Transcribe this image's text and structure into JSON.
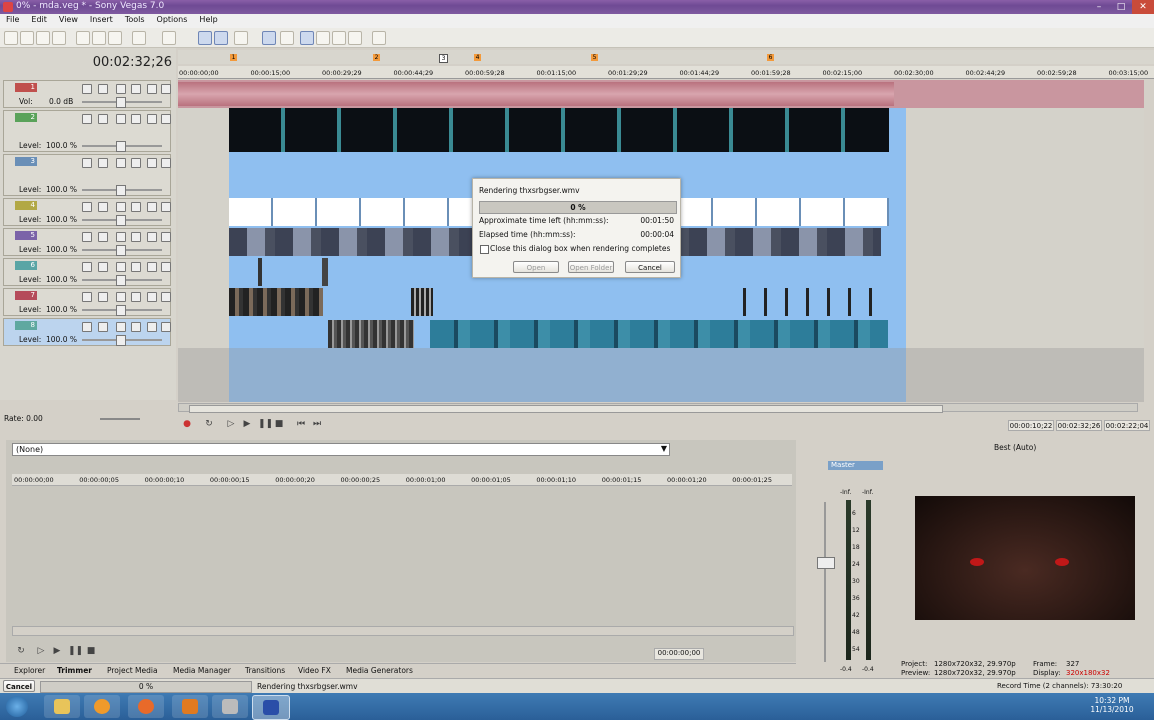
{
  "window": {
    "title": "0% - mda.veg * - Sony Vegas 7.0",
    "minimize": "–",
    "maximize": "□",
    "close": "✕"
  },
  "menu": [
    "File",
    "Edit",
    "View",
    "Insert",
    "Tools",
    "Options",
    "Help"
  ],
  "timecode": "00:02:32;26",
  "markers": [
    "1",
    "2",
    "3",
    "4",
    "5",
    "6"
  ],
  "ruler": [
    "00:00:00;00",
    "00:00:15;00",
    "00:00:29;29",
    "00:00:44;29",
    "00:00:59;28",
    "00:01:15;00",
    "00:01:29;29",
    "00:01:44;29",
    "00:01:59;28",
    "00:02:15;00",
    "00:02:30;00",
    "00:02:44;29",
    "00:02:59;28",
    "00:03:15;00"
  ],
  "tracks": [
    {
      "num": "1",
      "label": "Vol:",
      "value": "0.0 dB",
      "color": "#c0504d"
    },
    {
      "num": "2",
      "label": "Level:",
      "value": "100.0 %",
      "color": "#5aa25a"
    },
    {
      "num": "3",
      "label": "Level:",
      "value": "100.0 %",
      "color": "#6a8fb7"
    },
    {
      "num": "4",
      "label": "Level:",
      "value": "100.0 %",
      "color": "#b2a845"
    },
    {
      "num": "5",
      "label": "Level:",
      "value": "100.0 %",
      "color": "#7b63a8"
    },
    {
      "num": "6",
      "label": "Level:",
      "value": "100.0 %",
      "color": "#5aa5a5"
    },
    {
      "num": "7",
      "label": "Level:",
      "value": "100.0 %",
      "color": "#b54b5a"
    },
    {
      "num": "8",
      "label": "Level:",
      "value": "100.0 %",
      "color": "#5fa8a0"
    }
  ],
  "rate": "Rate: 0.00",
  "dialog": {
    "title": "Rendering thxsrbgser.wmv",
    "progress_pct": 0,
    "progress_label": "0 %",
    "time_left_label": "Approximate time left (hh:mm:ss):",
    "time_left": "00:01:50",
    "elapsed_label": "Elapsed time (hh:mm:ss):",
    "elapsed": "00:00:04",
    "checkbox_label": "Close this dialog box when rendering completes",
    "open": "Open",
    "open_folder": "Open Folder",
    "cancel": "Cancel"
  },
  "transport_times": [
    "00:00:10;22",
    "00:02:32;26",
    "00:02:22;04"
  ],
  "trimmer": {
    "source": "(None)",
    "ruler": [
      "00:00:00;00",
      "00:00:00;05",
      "00:00:00;10",
      "00:00:00;15",
      "00:00:00;20",
      "00:00:00;25",
      "00:00:01;00",
      "00:00:01;05",
      "00:00:01;10",
      "00:00:01;15",
      "00:00:01;20",
      "00:00:01;25"
    ],
    "timecode": "00:00:00;00"
  },
  "mixer": {
    "label": "Master",
    "inf_left": "-Inf.",
    "inf_right": "-Inf.",
    "scale": [
      "6",
      "12",
      "18",
      "24",
      "30",
      "36",
      "42",
      "48",
      "54"
    ],
    "peak_left": "-0.4",
    "peak_right": "-0.4"
  },
  "preview": {
    "quality": "Best (Auto)",
    "project_label": "Project:",
    "project": "1280x720x32, 29.970p",
    "preview_label": "Preview:",
    "preview": "1280x720x32, 29.970p",
    "frame_label": "Frame:",
    "frame": "327",
    "display_label": "Display:",
    "display": "320x180x32"
  },
  "tabs": [
    "Explorer",
    "Trimmer",
    "Project Media",
    "Media Manager",
    "Transitions",
    "Video FX",
    "Media Generators"
  ],
  "status": {
    "cancel": "Cancel",
    "progress": "0 %",
    "message": "Rendering thxsrbgser.wmv",
    "record_time": "Record Time (2 channels): 73:30:20"
  },
  "taskbar": {
    "time": "10:32 PM",
    "date": "11/13/2010"
  },
  "colors": {
    "timeline_loop": "#8fbff0",
    "marker": "#f39a3b",
    "taskbar": "#2a5f98"
  }
}
